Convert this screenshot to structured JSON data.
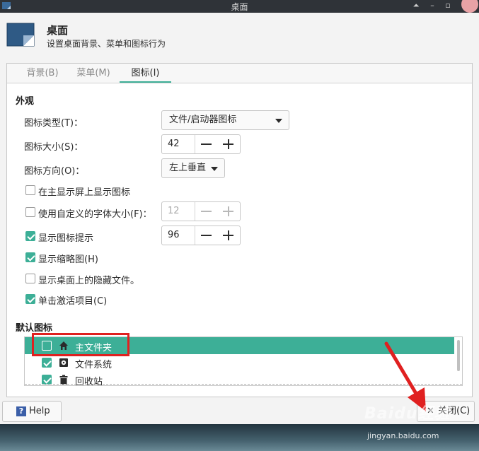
{
  "window": {
    "title": "桌面"
  },
  "header": {
    "title": "桌面",
    "subtitle": "设置桌面背景、菜单和图标行为"
  },
  "tabs": [
    {
      "label": "背景(B)",
      "active": false
    },
    {
      "label": "菜单(M)",
      "active": false
    },
    {
      "label": "图标(I)",
      "active": true
    }
  ],
  "appearance": {
    "section_title": "外观",
    "icon_type": {
      "label": "图标类型(T)：",
      "value": "文件/启动器图标"
    },
    "icon_size": {
      "label": "图标大小(S)：",
      "value": "42"
    },
    "icon_orientation": {
      "label": "图标方向(O)：",
      "value": "左上垂直"
    },
    "show_on_primary": {
      "label": "在主显示屏上显示图标",
      "checked": false
    },
    "custom_font_size": {
      "label": "使用自定义的字体大小(F)：",
      "checked": false,
      "value": "12"
    },
    "show_tooltips": {
      "label": "显示图标提示",
      "checked": true,
      "value": "96"
    },
    "show_thumbnails": {
      "label": "显示缩略图(H)",
      "checked": true
    },
    "show_hidden": {
      "label": "显示桌面上的隐藏文件。",
      "checked": false
    },
    "single_click": {
      "label": "单击激活项目(C)",
      "checked": true
    }
  },
  "default_icons": {
    "section_title": "默认图标",
    "items": [
      {
        "label": "主文件夹",
        "checked": false,
        "selected": true,
        "icon": "home-icon"
      },
      {
        "label": "文件系统",
        "checked": true,
        "selected": false,
        "icon": "drive-icon"
      },
      {
        "label": "回收站",
        "checked": true,
        "selected": false,
        "icon": "trash-icon"
      }
    ]
  },
  "buttons": {
    "help": "Help",
    "close": "关闭(C)",
    "close_glyph": "✕",
    "help_glyph": "?"
  },
  "watermark": {
    "brand": "Baidu经验",
    "url": "jingyan.baidu.com"
  },
  "colors": {
    "accent": "#3daf97",
    "annotation": "#e02020"
  }
}
